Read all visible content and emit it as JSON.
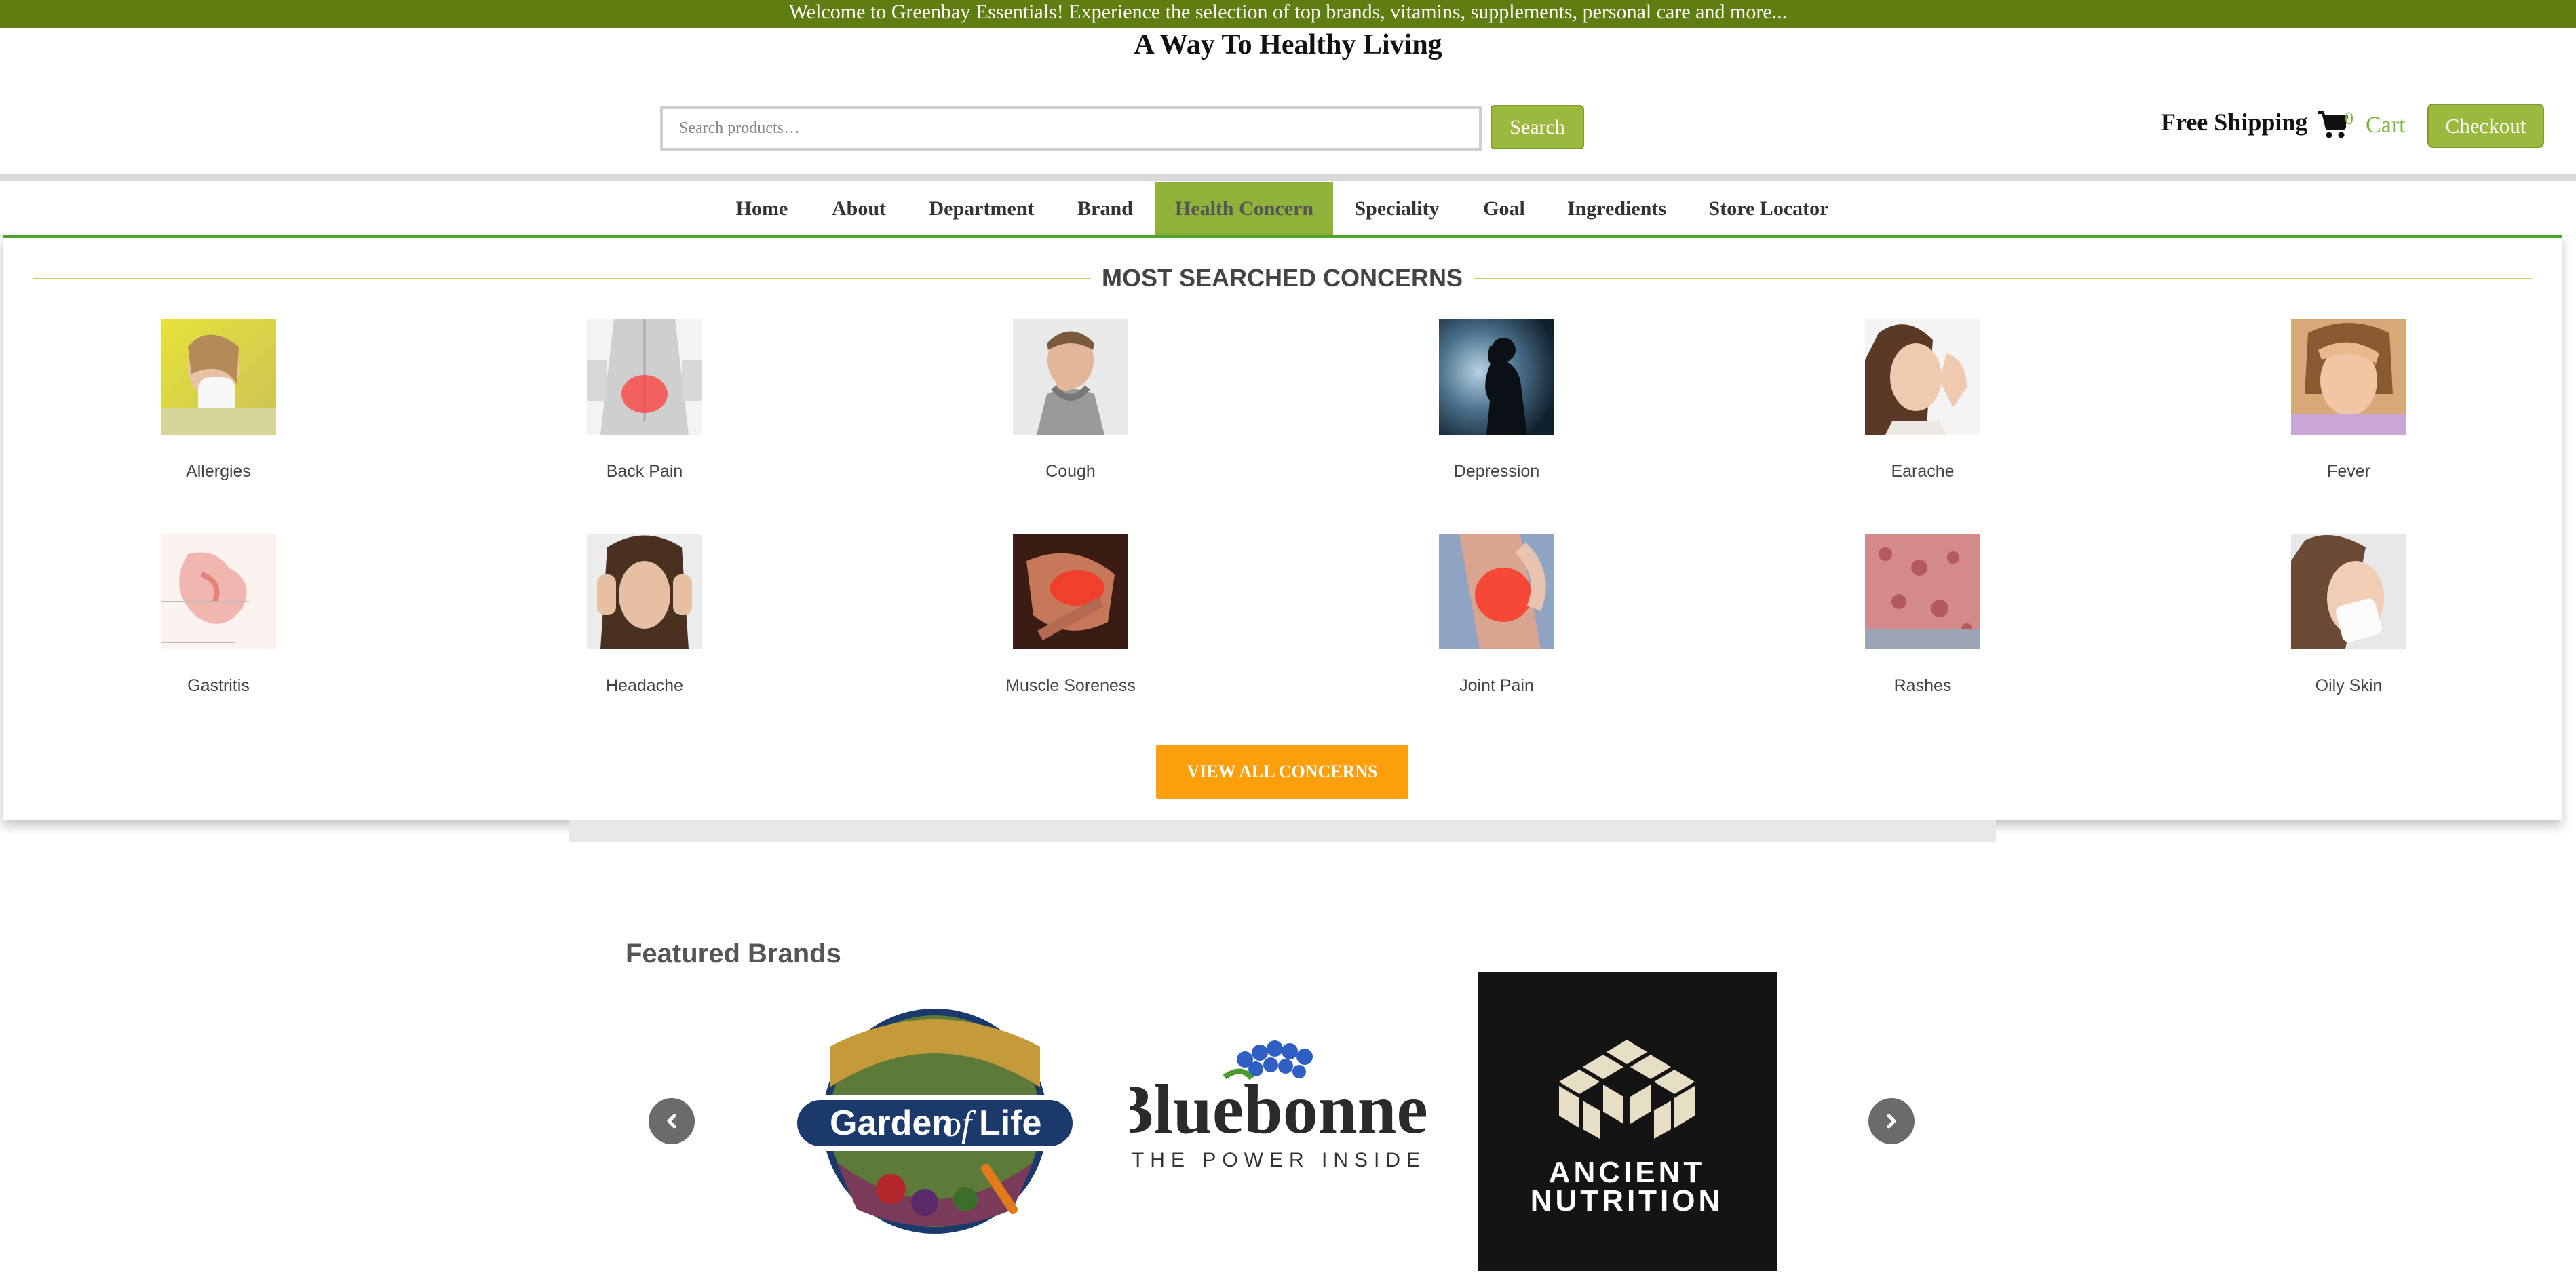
{
  "announcement": "Welcome to Greenbay Essentials! Experience the selection of top brands, vitamins, supplements, personal care and more...",
  "tagline": "A Way To Healthy Living",
  "search": {
    "placeholder": "Search products…",
    "button": "Search"
  },
  "header": {
    "free_shipping": "Free Shipping",
    "cart_count": "0",
    "cart_label": "Cart",
    "checkout": "Checkout"
  },
  "nav": {
    "items": [
      "Home",
      "About",
      "Department",
      "Brand",
      "Health Concern",
      "Speciality",
      "Goal",
      "Ingredients",
      "Store Locator"
    ],
    "active": "Health Concern"
  },
  "mega_menu": {
    "heading": "MOST SEARCHED CONCERNS",
    "concerns": [
      "Allergies",
      "Back Pain",
      "Cough",
      "Depression",
      "Earache",
      "Fever",
      "Gastritis",
      "Headache",
      "Muscle Soreness",
      "Joint Pain",
      "Rashes",
      "Oily Skin"
    ],
    "view_all": "VIEW ALL CONCERNS"
  },
  "featured": {
    "title": "Featured Brands",
    "brands": [
      {
        "name": "Garden of Life",
        "part1": "Garden",
        "part2": "of",
        "part3": "Life"
      },
      {
        "name": "Bluebonnet",
        "tagline": "THE POWER INSIDE"
      },
      {
        "name": "Ancient Nutrition",
        "line1": "ANCIENT",
        "line2": "NUTRITION"
      }
    ]
  },
  "colors": {
    "topbar": "#5f7d11",
    "accent_green": "#9cb93f",
    "cart_green": "#7ab83c",
    "orange": "#fb9f0c",
    "nav_active": "#8fb33a"
  }
}
